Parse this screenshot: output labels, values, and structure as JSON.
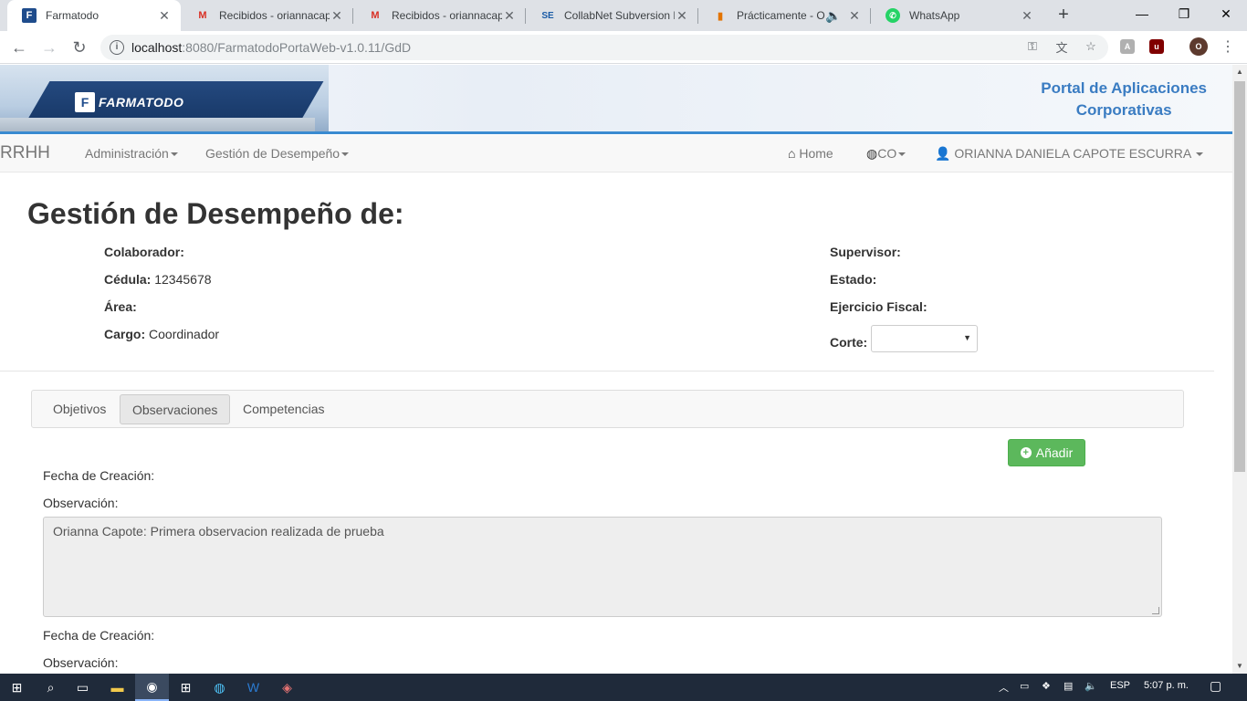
{
  "browser": {
    "tabs": [
      {
        "title": "Farmatodo",
        "favicon": "farmatodo-icon",
        "active": true
      },
      {
        "title": "Recibidos - oriannacapote",
        "favicon": "gmail-icon",
        "active": false
      },
      {
        "title": "Recibidos - oriannacapote",
        "favicon": "gmail-icon",
        "active": false
      },
      {
        "title": "CollabNet Subversion R",
        "favicon": "collabnet-icon",
        "active": false
      },
      {
        "title": "Prácticamente - On",
        "favicon": "chart-icon",
        "active": false
      },
      {
        "title": "WhatsApp",
        "favicon": "whatsapp-icon",
        "active": false
      }
    ],
    "url_host": "localhost",
    "url_path": ":8080/FarmatodoPortaWeb-v1.0.11/GdD",
    "profile_initial": "O"
  },
  "banner": {
    "logo_text": "FARMATODO",
    "portal_line1": "Portal de Aplicaciones",
    "portal_line2": "Corporativas"
  },
  "navbar": {
    "brand": "RRHH",
    "menu_admin": "Administración",
    "menu_gestion": "Gestión de Desempeño",
    "home": "Home",
    "country": "CO",
    "user": "ORIANNA DANIELA CAPOTE ESCURRA"
  },
  "page": {
    "title": "Gestión de Desempeño de:",
    "colaborador_label": "Colaborador:",
    "colaborador_value": "",
    "cedula_label": "Cédula:",
    "cedula_value": "12345678",
    "area_label": "Área:",
    "area_value": "",
    "cargo_label": "Cargo:",
    "cargo_value": "Coordinador",
    "supervisor_label": "Supervisor:",
    "estado_label": "Estado:",
    "ejercicio_label": "Ejercicio Fiscal:",
    "corte_label": "Corte:",
    "corte_value": ""
  },
  "tabs": {
    "objetivos": "Objetivos",
    "observaciones": "Observaciones",
    "competencias": "Competencias"
  },
  "actions": {
    "add_label": "Añadir"
  },
  "observations": [
    {
      "fecha_label": "Fecha de Creación:",
      "obs_label": "Observación:",
      "text": "Orianna Capote: Primera observacion realizada de prueba"
    },
    {
      "fecha_label": "Fecha de Creación:",
      "obs_label": "Observación:",
      "text": ""
    }
  ],
  "taskbar": {
    "lang": "ESP",
    "time": "5:07 p. m."
  }
}
